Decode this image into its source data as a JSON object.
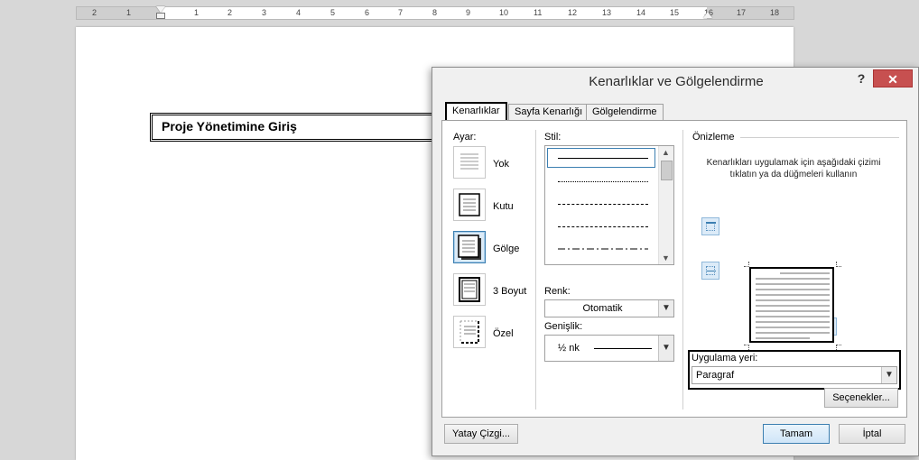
{
  "ruler": {
    "numbers": [
      "2",
      "1",
      "1",
      "2",
      "3",
      "4",
      "5",
      "6",
      "7",
      "8",
      "9",
      "10",
      "11",
      "12",
      "13",
      "14",
      "15",
      "16",
      "17",
      "18"
    ]
  },
  "document": {
    "heading": "Proje Yönetimine Giriş"
  },
  "dialog": {
    "title": "Kenarlıklar ve Gölgelendirme",
    "help": "?",
    "close": "✕",
    "tabs": [
      "Kenarlıklar",
      "Sayfa Kenarlığı",
      "Gölgelendirme"
    ],
    "setting": {
      "label": "Ayar:",
      "items": [
        "Yok",
        "Kutu",
        "Gölge",
        "3 Boyut",
        "Özel"
      ],
      "selected_index": 2
    },
    "style": {
      "label": "Stil:"
    },
    "color": {
      "label": "Renk:",
      "value": "Otomatik"
    },
    "width": {
      "label": "Genişlik:",
      "value": "½ nk"
    },
    "preview": {
      "label": "Önizleme",
      "instruction": "Kenarlıkları uygulamak için aşağıdaki çizimi tıklatın ya da düğmeleri kullanın"
    },
    "apply_to": {
      "label": "Uygulama yeri:",
      "value": "Paragraf"
    },
    "options_button": "Seçenekler...",
    "horizontal_line_button": "Yatay Çizgi...",
    "ok_button": "Tamam",
    "cancel_button": "İptal"
  }
}
